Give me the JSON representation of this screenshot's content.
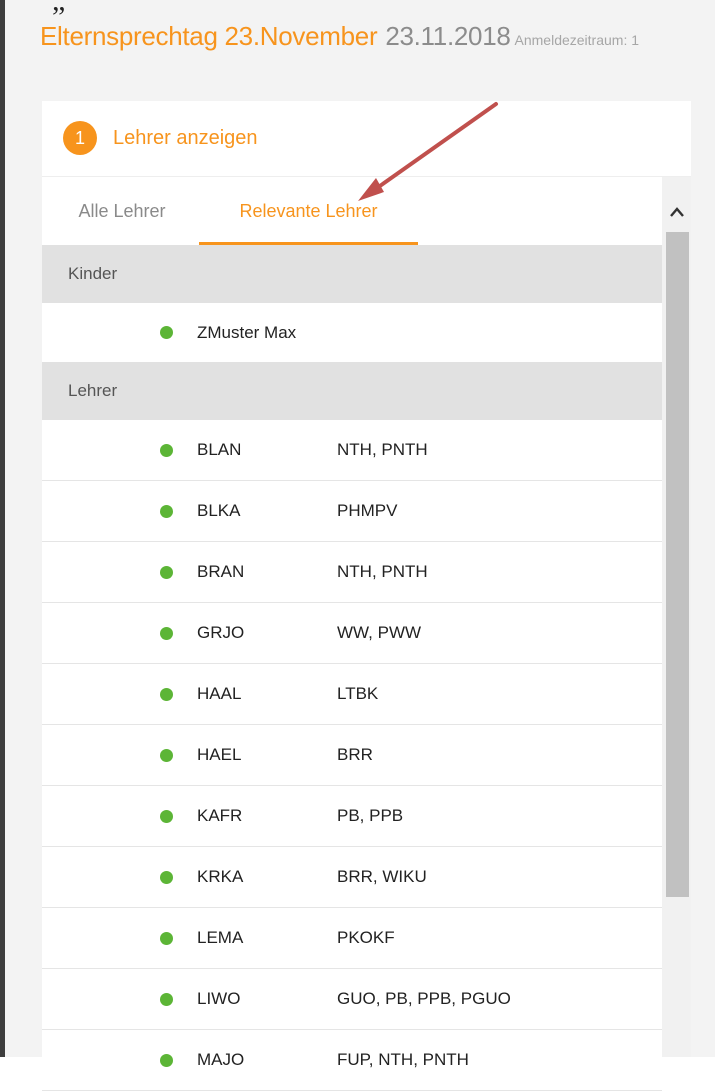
{
  "header": {
    "quote": "„",
    "title": "Elternsprechtag 23.November",
    "date": "23.11.2018",
    "period": "Anmeldezeitraum: 1"
  },
  "step": {
    "number": "1",
    "label": "Lehrer anzeigen"
  },
  "tabs": [
    {
      "label": "Alle Lehrer",
      "active": false
    },
    {
      "label": "Relevante Lehrer",
      "active": true
    }
  ],
  "sections": {
    "children": {
      "title": "Kinder",
      "items": [
        {
          "name": "ZMuster Max"
        }
      ]
    },
    "teachers": {
      "title": "Lehrer",
      "items": [
        {
          "code": "BLAN",
          "subjects": "NTH, PNTH"
        },
        {
          "code": "BLKA",
          "subjects": "PHMPV"
        },
        {
          "code": "BRAN",
          "subjects": "NTH, PNTH"
        },
        {
          "code": "GRJO",
          "subjects": "WW, PWW"
        },
        {
          "code": "HAAL",
          "subjects": "LTBK"
        },
        {
          "code": "HAEL",
          "subjects": "BRR"
        },
        {
          "code": "KAFR",
          "subjects": "PB, PPB"
        },
        {
          "code": "KRKA",
          "subjects": "BRR, WIKU"
        },
        {
          "code": "LEMA",
          "subjects": "PKOKF"
        },
        {
          "code": "LIWO",
          "subjects": "GUO, PB, PPB, PGUO"
        },
        {
          "code": "MAJO",
          "subjects": "FUP, NTH, PNTH"
        }
      ]
    }
  },
  "colors": {
    "accent": "#f7941d",
    "status_dot": "#5cb536",
    "annotation_arrow": "#c0504d"
  },
  "icons": {
    "status": "green-dot-icon",
    "scroll_up": "chevron-up-icon",
    "annotation": "arrow-annotation-icon"
  }
}
